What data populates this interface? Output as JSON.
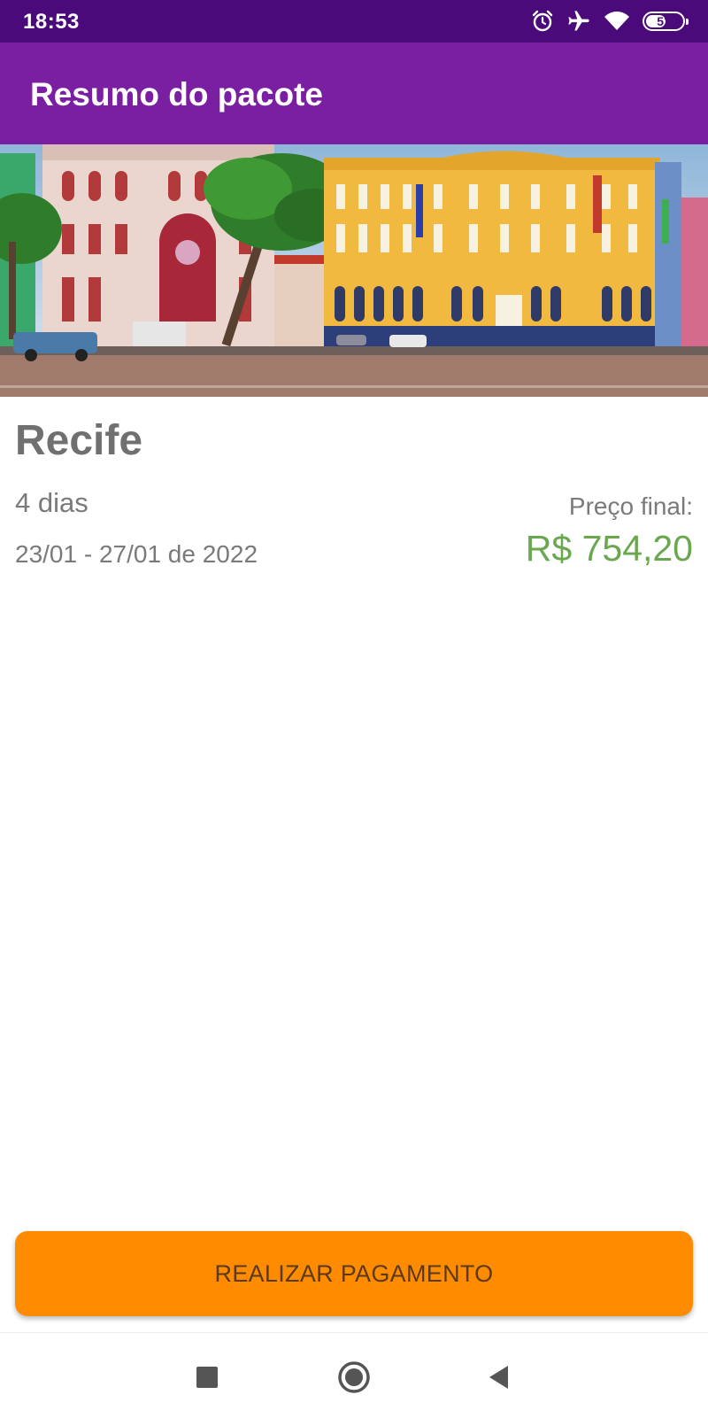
{
  "status_bar": {
    "time": "18:53",
    "icons": [
      "alarm-icon",
      "airplane-mode-icon",
      "wifi-icon",
      "battery-icon"
    ],
    "battery_level": "51"
  },
  "app_bar": {
    "title": "Resumo do pacote"
  },
  "banner": {
    "image_subject": "colorful colonial buildings street scene"
  },
  "package": {
    "city": "Recife",
    "days": "4 dias",
    "dates": "23/01 - 27/01 de 2022",
    "price_label": "Preço final:",
    "price_value": "R$ 754,20"
  },
  "actions": {
    "pay_label": "REALIZAR PAGAMENTO"
  },
  "nav_bar": {
    "icons": [
      "recents-icon",
      "home-icon",
      "back-icon"
    ]
  },
  "colors": {
    "status_bar": "#4b0a7a",
    "app_bar": "#7b1fa2",
    "price": "#6aa84f",
    "button": "#ff8c00"
  }
}
